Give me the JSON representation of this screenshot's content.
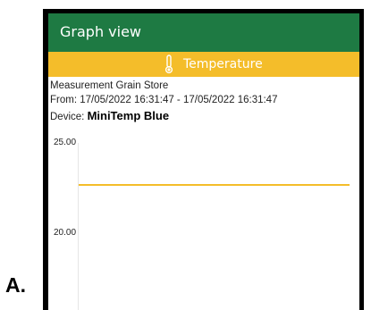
{
  "figure_label": "A.",
  "app_bar": {
    "title": "Graph view"
  },
  "tab": {
    "label": "Temperature",
    "icon": "thermometer-icon"
  },
  "info": {
    "measurement": "Measurement Grain Store",
    "range": "From: 17/05/2022 16:31:47 - 17/05/2022 16:31:47",
    "device_prefix": "Device:",
    "device_name": "MiniTemp Blue"
  },
  "chart_data": {
    "type": "line",
    "y_ticks": [
      "25.00",
      "20.00"
    ],
    "series": [
      {
        "values": [
          23.0,
          23.0
        ]
      }
    ],
    "colors": {
      "series": "#f4bd2a"
    }
  },
  "colors": {
    "app_bar": "#1e7a43",
    "tab_bar": "#f4bd2a"
  }
}
